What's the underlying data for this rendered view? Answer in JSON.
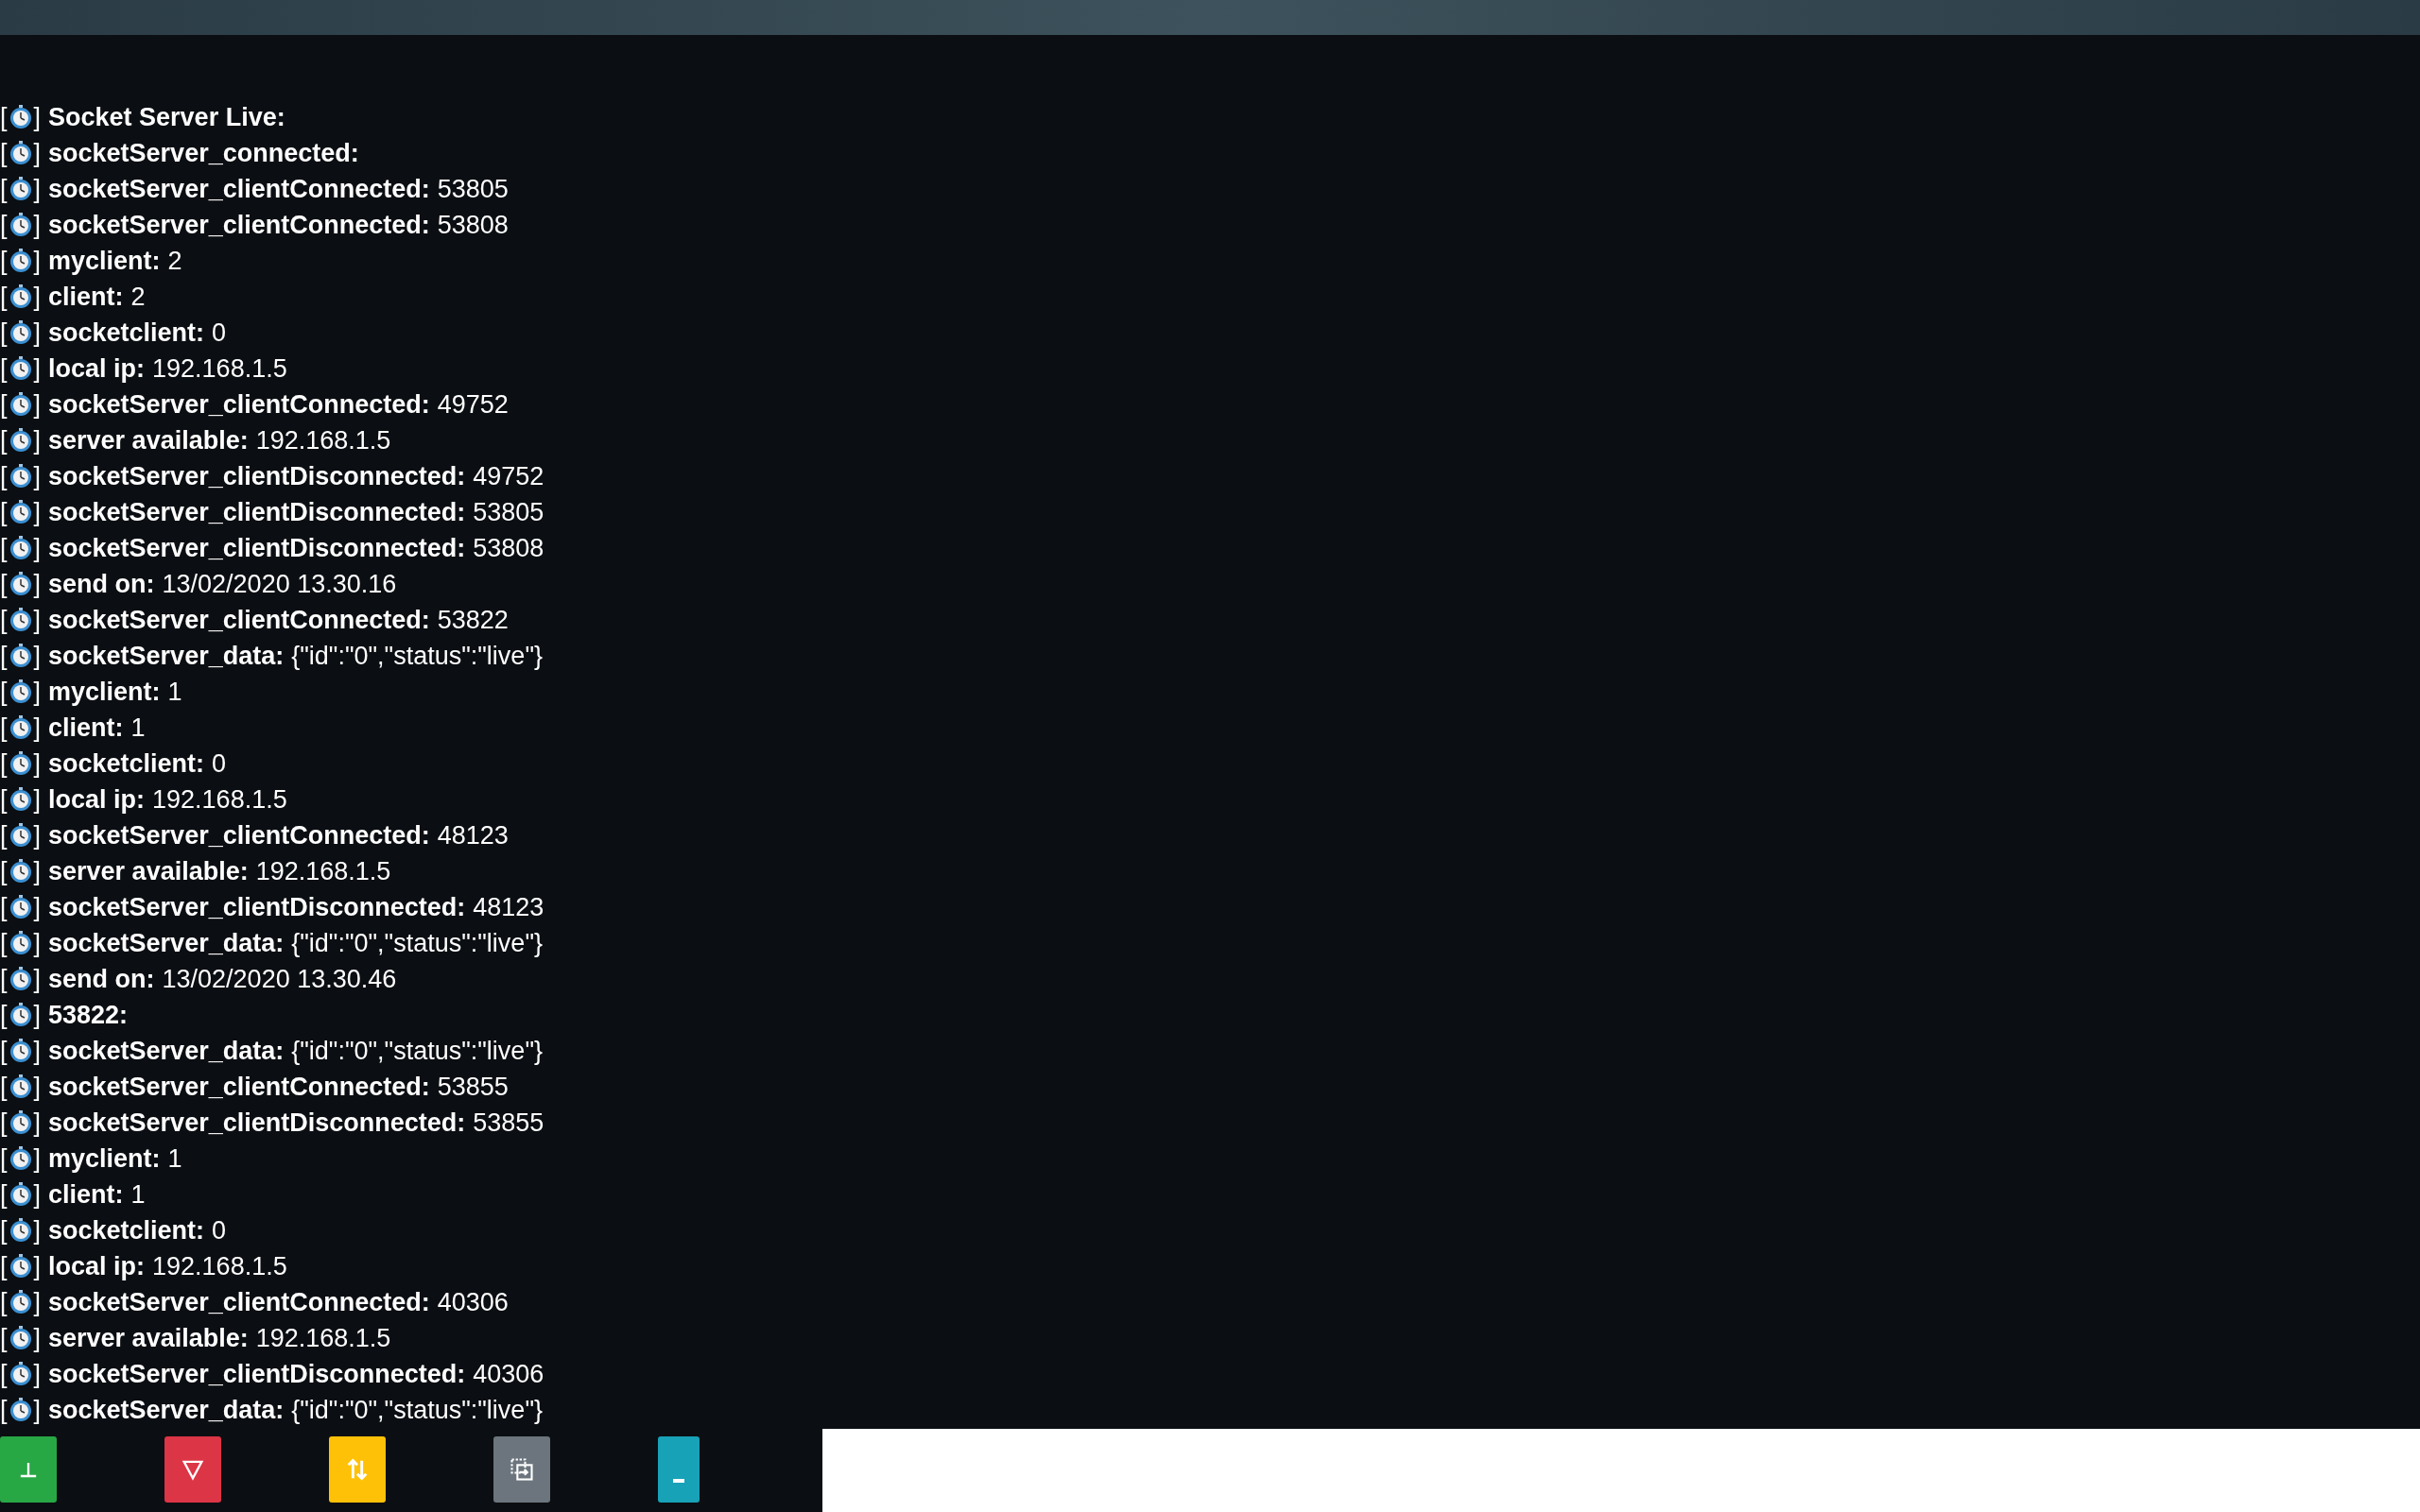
{
  "log": [
    {
      "open": "[",
      "close": "]",
      "key": "Socket Server Live:"
    },
    {
      "open": "[",
      "close": "]",
      "key": "socketServer_connected:"
    },
    {
      "open": "[",
      "close": "]",
      "key": "socketServer_clientConnected:",
      "value": "53805"
    },
    {
      "open": "[",
      "close": "]",
      "key": "socketServer_clientConnected:",
      "value": "53808"
    },
    {
      "open": "[",
      "close": "]",
      "key": "myclient:",
      "value": "2"
    },
    {
      "open": "[",
      "close": "]",
      "key": "client:",
      "value": "2"
    },
    {
      "open": "[",
      "close": "]",
      "key": "socketclient:",
      "value": "0"
    },
    {
      "open": "[",
      "close": "]",
      "key": "local ip:",
      "value": "192.168.1.5"
    },
    {
      "open": "[",
      "close": "]",
      "key": "socketServer_clientConnected:",
      "value": "49752"
    },
    {
      "open": "[",
      "close": "]",
      "key": "server available:",
      "value": "192.168.1.5"
    },
    {
      "open": "[",
      "close": "]",
      "key": "socketServer_clientDisconnected:",
      "value": "49752"
    },
    {
      "open": "[",
      "close": "]",
      "key": "socketServer_clientDisconnected:",
      "value": "53805"
    },
    {
      "open": "[",
      "close": "]",
      "key": "socketServer_clientDisconnected:",
      "value": "53808"
    },
    {
      "open": "[",
      "close": "]",
      "key": "send on:",
      "value": "13/02/2020 13.30.16"
    },
    {
      "open": "[",
      "close": "]",
      "key": "socketServer_clientConnected:",
      "value": "53822"
    },
    {
      "open": "[",
      "close": "]",
      "key": "socketServer_data:",
      "value": "{\"id\":\"0\",\"status\":\"live\"}"
    },
    {
      "open": "[",
      "close": "]",
      "key": "myclient:",
      "value": "1"
    },
    {
      "open": "[",
      "close": "]",
      "key": "client:",
      "value": "1"
    },
    {
      "open": "[",
      "close": "]",
      "key": "socketclient:",
      "value": "0"
    },
    {
      "open": "[",
      "close": "]",
      "key": "local ip:",
      "value": "192.168.1.5"
    },
    {
      "open": "[",
      "close": "]",
      "key": "socketServer_clientConnected:",
      "value": "48123"
    },
    {
      "open": "[",
      "close": "]",
      "key": "server available:",
      "value": "192.168.1.5"
    },
    {
      "open": "[",
      "close": "]",
      "key": "socketServer_clientDisconnected:",
      "value": "48123"
    },
    {
      "open": "[",
      "close": "]",
      "key": "socketServer_data:",
      "value": "{\"id\":\"0\",\"status\":\"live\"}"
    },
    {
      "open": "[",
      "close": "]",
      "key": "send on:",
      "value": "13/02/2020 13.30.46"
    },
    {
      "open": "[",
      "close": "]",
      "key": "53822:"
    },
    {
      "open": "[",
      "close": "]",
      "key": "socketServer_data:",
      "value": "{\"id\":\"0\",\"status\":\"live\"}"
    },
    {
      "open": "[",
      "close": "]",
      "key": "socketServer_clientConnected:",
      "value": "53855"
    },
    {
      "open": "[",
      "close": "]",
      "key": "socketServer_clientDisconnected:",
      "value": "53855"
    },
    {
      "open": "[",
      "close": "]",
      "key": "myclient:",
      "value": "1"
    },
    {
      "open": "[",
      "close": "]",
      "key": "client:",
      "value": "1"
    },
    {
      "open": "[",
      "close": "]",
      "key": "socketclient:",
      "value": "0"
    },
    {
      "open": "[",
      "close": "]",
      "key": "local ip:",
      "value": "192.168.1.5"
    },
    {
      "open": "[",
      "close": "]",
      "key": "socketServer_clientConnected:",
      "value": "40306"
    },
    {
      "open": "[",
      "close": "]",
      "key": "server available:",
      "value": "192.168.1.5"
    },
    {
      "open": "[",
      "close": "]",
      "key": "socketServer_clientDisconnected:",
      "value": "40306"
    },
    {
      "open": "[",
      "close": "]",
      "key": "socketServer_data:",
      "value": "{\"id\":\"0\",\"status\":\"live\"}"
    }
  ],
  "buttons": [
    {
      "kind": "up-tack",
      "color": "#28a745"
    },
    {
      "kind": "triangle-down",
      "color": "#dc3545"
    },
    {
      "kind": "swap",
      "color": "#ffc107"
    },
    {
      "kind": "copy",
      "color": "#6c757d"
    },
    {
      "kind": "underscore",
      "color": "#17a2b8"
    }
  ]
}
